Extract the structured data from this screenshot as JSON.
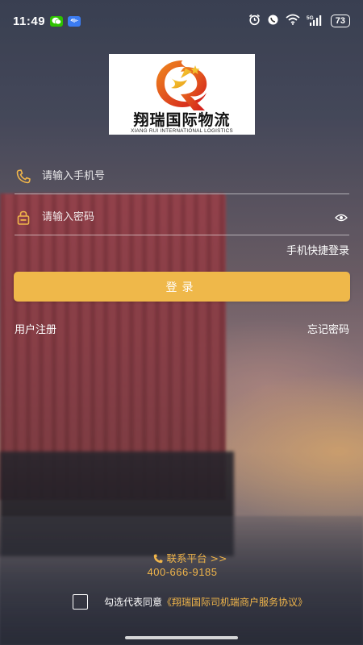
{
  "status_bar": {
    "time": "11:49",
    "apps": [
      "wechat-icon",
      "message-icon"
    ],
    "battery": "73",
    "network": "5G"
  },
  "logo": {
    "cn": "翔瑞国际物流",
    "en": "XIANG RUI INTERNATIONAL LOGISTICS"
  },
  "form": {
    "phone_placeholder": "请输入手机号",
    "password_placeholder": "请输入密码",
    "quick_login_label": "手机快捷登录",
    "login_label": "登录",
    "register_label": "用户注册",
    "forgot_label": "忘记密码"
  },
  "contact": {
    "label": "联系平台 >>",
    "phone": "400-666-9185"
  },
  "agreement": {
    "text": "勾选代表同意",
    "link": "《翔瑞国际司机端商户服务协议》"
  },
  "colors": {
    "accent": "#efb84a",
    "link": "#f0b54a"
  }
}
